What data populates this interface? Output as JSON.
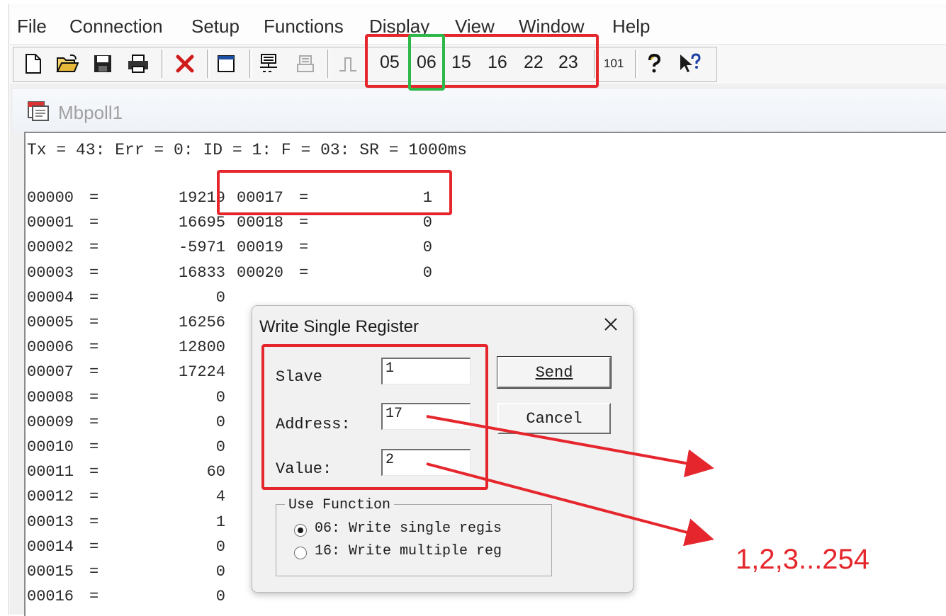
{
  "menu": {
    "file": "File",
    "connection": "Connection",
    "setup": "Setup",
    "functions": "Functions",
    "display": "Display",
    "view": "View",
    "window": "Window",
    "help": "Help"
  },
  "toolbar": {
    "fn05": "05",
    "fn06": "06",
    "fn15": "15",
    "fn16": "16",
    "fn22": "22",
    "fn23": "23",
    "fn101": "101"
  },
  "child_window": {
    "title": "Mbpoll1",
    "status_line": "Tx = 43: Err = 0: ID = 1: F = 03: SR = 1000ms"
  },
  "registers": {
    "col1": [
      {
        "addr": "00000",
        "value": "19219"
      },
      {
        "addr": "00001",
        "value": "16695"
      },
      {
        "addr": "00002",
        "value": "-5971"
      },
      {
        "addr": "00003",
        "value": "16833"
      },
      {
        "addr": "00004",
        "value": "0"
      },
      {
        "addr": "00005",
        "value": "16256"
      },
      {
        "addr": "00006",
        "value": "12800"
      },
      {
        "addr": "00007",
        "value": "17224"
      },
      {
        "addr": "00008",
        "value": "0"
      },
      {
        "addr": "00009",
        "value": "0"
      },
      {
        "addr": "00010",
        "value": "0"
      },
      {
        "addr": "00011",
        "value": "60"
      },
      {
        "addr": "00012",
        "value": "4"
      },
      {
        "addr": "00013",
        "value": "1"
      },
      {
        "addr": "00014",
        "value": "0"
      },
      {
        "addr": "00015",
        "value": "0"
      },
      {
        "addr": "00016",
        "value": "0"
      }
    ],
    "col2": [
      {
        "addr": "00017",
        "value": "1"
      },
      {
        "addr": "00018",
        "value": "0"
      },
      {
        "addr": "00019",
        "value": "0"
      },
      {
        "addr": "00020",
        "value": "0"
      }
    ]
  },
  "dialog": {
    "title": "Write Single Register",
    "slave_label": "Slave",
    "slave_value": "1",
    "address_label": "Address:",
    "address_value": "17",
    "value_label": "Value:",
    "value_value": "2",
    "send_label": "Send",
    "cancel_label": "Cancel",
    "group_label": "Use Function",
    "option1": "06: Write single regis",
    "option2": "16: Write multiple reg"
  },
  "annotation": {
    "range_text": "1,2,3...254",
    "accent_color": "#e5262d",
    "highlight_color": "#2fb84a"
  }
}
